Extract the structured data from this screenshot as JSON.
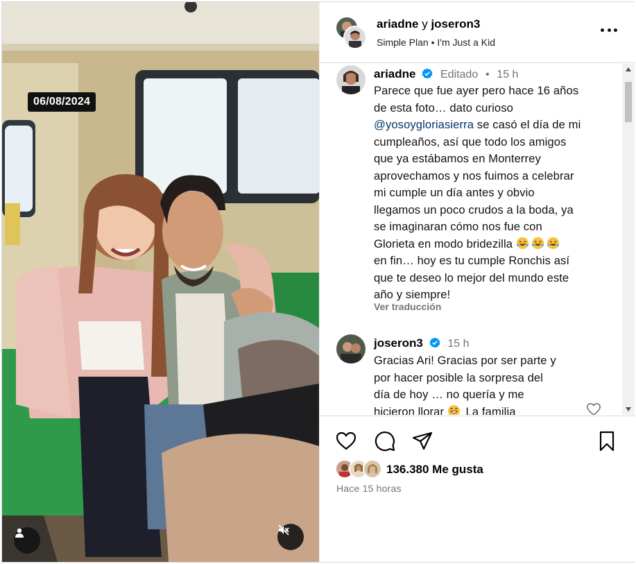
{
  "media": {
    "date_badge": "06/08/2024"
  },
  "header": {
    "user1": "ariadne",
    "connector": "y",
    "user2": "joseron3",
    "song_artist": "Simple Plan",
    "song_separator": "•",
    "song_title": "I'm Just a Kid"
  },
  "comments": [
    {
      "username": "ariadne",
      "edited": "Editado",
      "dot": "•",
      "time": "15 h",
      "lines": [
        "Parece que fue ayer pero hace 16 años",
        "de esta foto… dato curioso",
        "se casó el día de mi",
        "cumpleaños, así que todo los amigos",
        "que ya estábamos en Monterrey",
        "aprovechamos y nos fuimos a celebrar",
        "mi cumple un día antes y obvio",
        "llegamos un poco crudos a la boda, ya",
        "se imaginaran cómo nos fue con",
        "Glorieta en modo bridezilla",
        "en fin… hoy es tu cumple Ronchis así",
        "que te deseo lo mejor del mundo este",
        "año y siempre!"
      ],
      "mention": "@yosoygloriasierra",
      "see_translation": "Ver traducción"
    },
    {
      "username": "joseron3",
      "time": "15 h",
      "lines": [
        "Gracias Ari! Gracias por ser parte y",
        "por hacer posible la sorpresa del",
        "día de hoy … no quería y me",
        "hicieron llorar",
        "La familia"
      ]
    }
  ],
  "footer": {
    "likes": "136.380 Me gusta",
    "time_ago": "Hace 15 horas"
  },
  "colors": {
    "verified": "#0095f6",
    "mention": "#00376b",
    "secondary_text": "#737373",
    "divider": "#dbdbdb"
  },
  "icons": [
    "heart-icon",
    "comment-icon",
    "share-icon",
    "bookmark-icon",
    "more-icon",
    "user-tag-icon",
    "mute-icon",
    "verified-badge-icon"
  ]
}
